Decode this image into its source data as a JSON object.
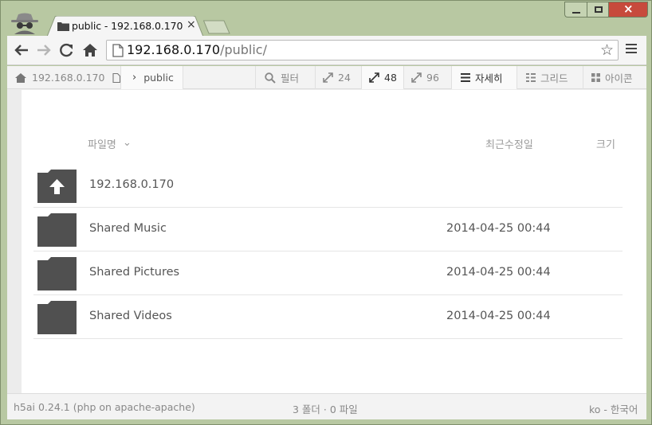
{
  "browser": {
    "tab": {
      "title": "public - 192.168.0.170",
      "title_overflow": " >",
      "close_glyph": "×"
    },
    "omnibox": {
      "host": "192.168.0.170",
      "path": "/public/"
    },
    "star_glyph": "☆",
    "close_glyph": "×"
  },
  "breadcrumb": {
    "host": "192.168.0.170",
    "current": "public",
    "chevron": "›"
  },
  "toolbar": {
    "filter_label": "필터",
    "size_24": "24",
    "size_48": "48",
    "size_96": "96",
    "view_details": "자세히",
    "view_grid": "그리드",
    "view_icons": "아이콘"
  },
  "columns": {
    "name": "파일명",
    "name_sort": "⌄",
    "date": "최근수정일",
    "size": "크기"
  },
  "rows": [
    {
      "name": "192.168.0.170",
      "date": "",
      "icon": "folder-parent-icon"
    },
    {
      "name": "Shared Music",
      "date": "2014-04-25 00:44",
      "icon": "folder-icon"
    },
    {
      "name": "Shared Pictures",
      "date": "2014-04-25 00:44",
      "icon": "folder-icon"
    },
    {
      "name": "Shared Videos",
      "date": "2014-04-25 00:44",
      "icon": "folder-icon"
    }
  ],
  "status": {
    "version": "h5ai 0.24.1 (php on apache-apache)",
    "summary": "3 폴더 · 0 파일",
    "language": "ko - 한국어"
  },
  "colors": {
    "frame": "#b8c8a2",
    "folder": "#505050",
    "close_button": "#c74a3c"
  }
}
